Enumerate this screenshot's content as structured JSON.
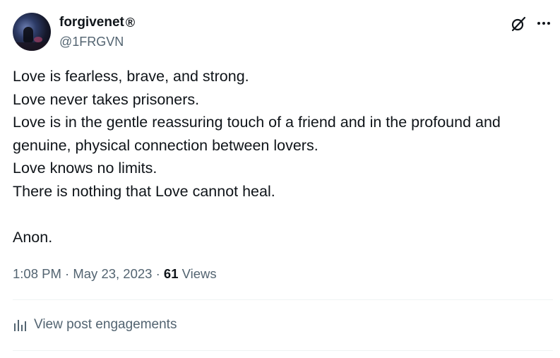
{
  "author": {
    "display_name": "forgivenet",
    "badge_symbol": "®",
    "handle": "@1FRGVN"
  },
  "icons": {
    "grok": "grok-icon",
    "more": "more-horizontal-icon",
    "engagements": "bar-chart-icon"
  },
  "tweet": {
    "lines": [
      "Love is fearless, brave, and strong.",
      "Love never takes prisoners.",
      "Love is in the gentle reassuring touch of a friend and in the profound and",
      "genuine, physical connection between lovers.",
      "Love knows no limits.",
      "There is nothing that Love cannot heal.",
      "",
      "Anon."
    ]
  },
  "meta": {
    "time": "1:08 PM",
    "separator": "·",
    "date": "May 23, 2023",
    "views_count": "61",
    "views_label": "Views"
  },
  "engagements": {
    "label": "View post engagements"
  },
  "colors": {
    "text_primary": "#0f1419",
    "text_secondary": "#536471",
    "divider": "#eff3f4"
  }
}
